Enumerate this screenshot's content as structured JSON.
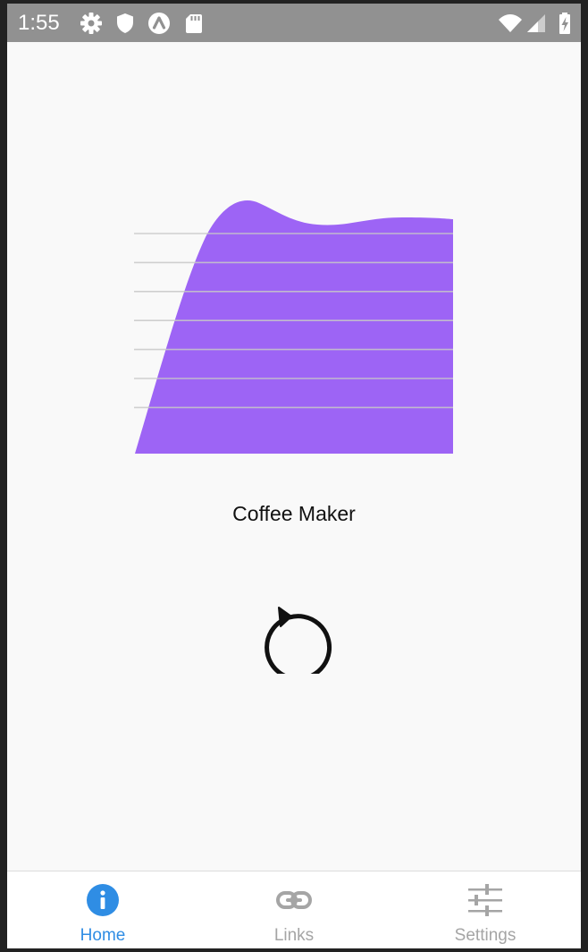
{
  "status_bar": {
    "time": "1:55",
    "left_icons": [
      "gear-icon",
      "shield-icon",
      "a-circle-icon",
      "sd-card-icon"
    ],
    "right_icons": [
      "wifi-icon",
      "signal-icon",
      "battery-charging-icon"
    ]
  },
  "device": {
    "name": "Coffee Maker",
    "level_chart": {
      "type": "area",
      "fill_color": "#9d64f5",
      "grid_color": "#c8c8c8",
      "gridline_count": 7
    }
  },
  "actions": {
    "refresh_icon": "refresh-icon"
  },
  "tabs": [
    {
      "label": "Home",
      "icon": "info-circle-icon",
      "active": true
    },
    {
      "label": "Links",
      "icon": "link-icon",
      "active": false
    },
    {
      "label": "Settings",
      "icon": "sliders-icon",
      "active": false
    }
  ],
  "colors": {
    "status_bar": "#919191",
    "background": "#f9f9f9",
    "accent": "#2f8de4",
    "inactive_tab": "#a5a5a5",
    "text": "#111111"
  }
}
